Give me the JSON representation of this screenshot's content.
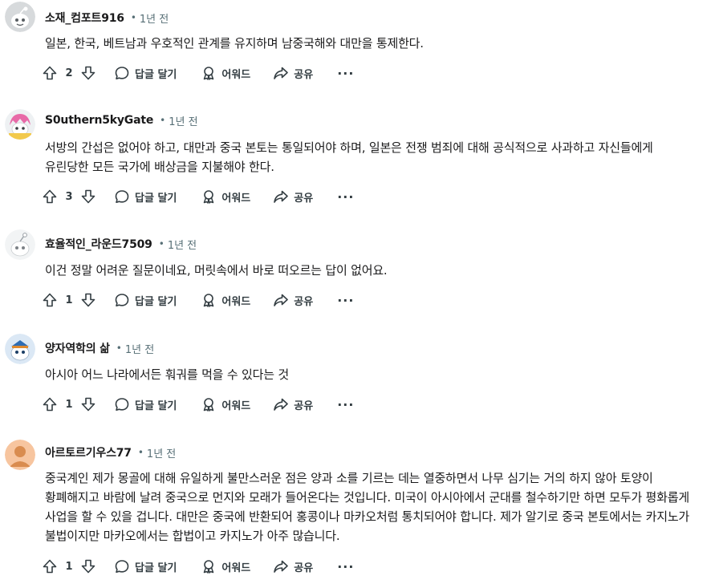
{
  "comments": [
    {
      "username": "소재_컴포트916",
      "time": "1년 전",
      "avatar": "snoo-gray-avatar",
      "text": "일본, 한국, 베트남과 우호적인 관계를 유지하며 남중국해와 대만을 통제한다.",
      "score": "2",
      "reply_label": "답글 달기",
      "award_label": "어워드",
      "share_label": "공유",
      "more_label": "···"
    },
    {
      "username": "S0uthern5kyGate",
      "time": "1년 전",
      "avatar": "snoo-pink-hair-avatar",
      "text": "서방의 간섭은 없어야 하고, 대만과 중국 본토는 통일되어야 하며, 일본은 전쟁 범죄에 대해 공식적으로 사과하고 자신들에게 유린당한 모든 국가에 배상금을 지불해야 한다.",
      "score": "3",
      "reply_label": "답글 달기",
      "award_label": "어워드",
      "share_label": "공유",
      "more_label": "···"
    },
    {
      "username": "효율적인_라운드7509",
      "time": "1년 전",
      "avatar": "snoo-light-avatar",
      "text": "이건 정말 어려운 질문이네요, 머릿속에서 바로 떠오르는 답이 없어요.",
      "score": "1",
      "reply_label": "답글 달기",
      "award_label": "어워드",
      "share_label": "공유",
      "more_label": "···"
    },
    {
      "username": "양자역학의 삶",
      "time": "1년 전",
      "avatar": "snoo-blue-avatar",
      "text": "아시아 어느 나라에서든 훠궈를 먹을 수 있다는 것",
      "score": "1",
      "reply_label": "답글 달기",
      "award_label": "어워드",
      "share_label": "공유",
      "more_label": "···"
    },
    {
      "username": "아르토르기우스77",
      "time": "1년 전",
      "avatar": "default-orange-avatar",
      "text": "중국계인 제가 몽골에 대해 유일하게 불만스러운 점은 양과 소를 기르는 데는 열중하면서 나무 심기는 거의 하지 않아 토양이 황폐해지고 바람에 날려 중국으로 먼지와 모래가 들어온다는 것입니다. 미국이 아시아에서 군대를 철수하기만 하면 모두가 평화롭게 사업을 할 수 있을 겁니다. 대만은 중국에 반환되어 홍콩이나 마카오처럼 통치되어야 합니다. 제가 알기로 중국 본토에서는 카지노가 불법이지만 마카오에서는 합법이고 카지노가 아주 많습니다.",
      "score": "1",
      "reply_label": "답글 달기",
      "award_label": "어워드",
      "share_label": "공유",
      "more_label": "···"
    }
  ]
}
